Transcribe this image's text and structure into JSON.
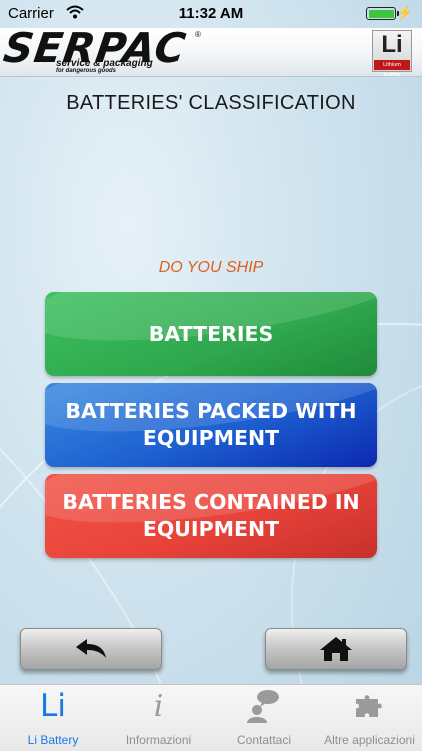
{
  "status_bar": {
    "carrier": "Carrier",
    "time": "11:32 AM"
  },
  "header": {
    "logo": {
      "brand": "SERPAC",
      "registered": "®",
      "tagline": "service & packaging",
      "subtagline": "for dangerous goods"
    },
    "badge": {
      "symbol": "Li",
      "caption": "Lithium battery"
    }
  },
  "page": {
    "title": "BATTERIES' CLASSIFICATION",
    "question": "DO YOU SHIP",
    "options": [
      {
        "label": "BATTERIES",
        "color": "#2fa84e"
      },
      {
        "label": "BATTERIES PACKED WITH EQUIPMENT",
        "color": "#1d5fd0"
      },
      {
        "label": "BATTERIES CONTAINED IN EQUIPMENT",
        "color": "#e8433a"
      }
    ]
  },
  "nav": {
    "back_icon": "back-arrow-icon",
    "home_icon": "home-icon"
  },
  "tabbar": {
    "active_color": "#1a7ae0",
    "tabs": [
      {
        "label": "Li Battery",
        "icon": "li-icon",
        "active": true
      },
      {
        "label": "Informazioni",
        "icon": "info-icon",
        "active": false
      },
      {
        "label": "Contattaci",
        "icon": "contact-icon",
        "active": false
      },
      {
        "label": "Altre applicazioni",
        "icon": "puzzle-icon",
        "active": false
      }
    ]
  }
}
